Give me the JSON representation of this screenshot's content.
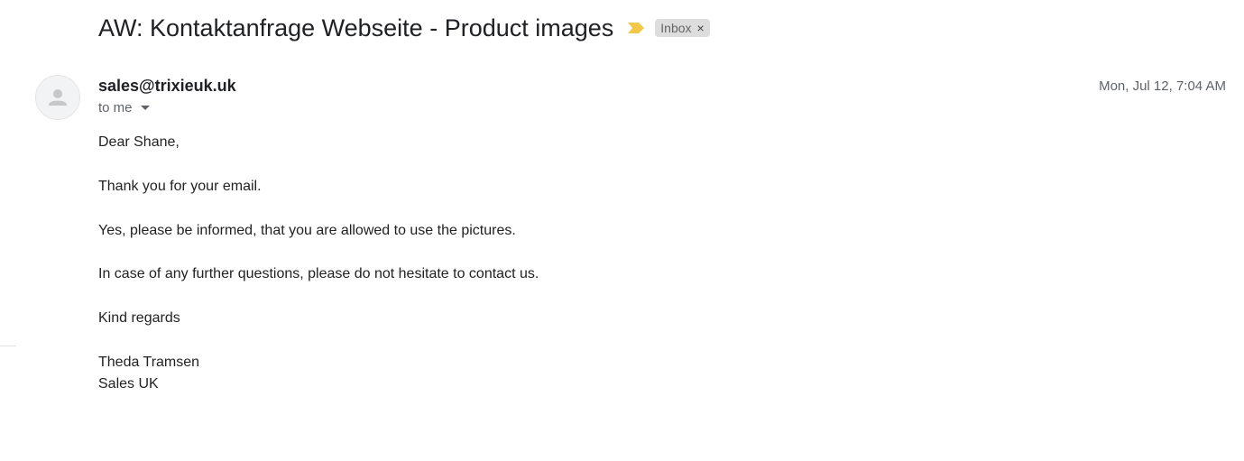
{
  "email": {
    "subject": "AW: Kontaktanfrage Webseite - Product images",
    "importance_icon": "importance-marker-icon",
    "label": "Inbox",
    "label_remove": "×",
    "sender": "sales@trixieuk.uk",
    "recipient": "to me",
    "date": "Mon, Jul 12, 7:04 AM",
    "body": {
      "greeting": "Dear Shane,",
      "line1": "Thank you for your email.",
      "line2": "Yes, please be informed, that you are allowed to use the pictures.",
      "line3": "In case of any further questions, please do not hesitate to contact us.",
      "closing": "Kind regards",
      "signature_name": "Theda Tramsen",
      "signature_title": "Sales UK"
    }
  },
  "colors": {
    "importance": "#f2c84b",
    "label_bg": "#dddddd",
    "avatar_bg": "#f1f3f4"
  }
}
